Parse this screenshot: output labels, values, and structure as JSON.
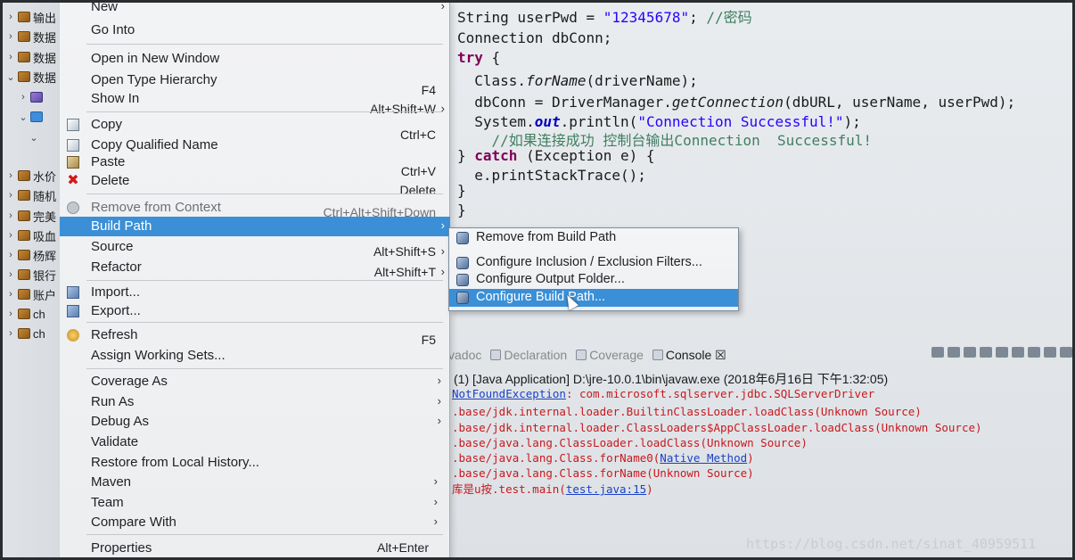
{
  "explorer": {
    "rows": [
      {
        "label": "输出",
        "twisty": "›"
      },
      {
        "label": "数据",
        "twisty": "›"
      },
      {
        "label": "数据",
        "twisty": "›"
      },
      {
        "label": "数据",
        "twisty": "⌄"
      },
      {
        "label": "",
        "twisty": "›"
      },
      {
        "label": "",
        "twisty": "⌄"
      },
      {
        "label": "",
        "twisty": "⌄"
      },
      {
        "label": "水价",
        "twisty": "›"
      },
      {
        "label": "随机",
        "twisty": "›"
      },
      {
        "label": "完美",
        "twisty": "›"
      },
      {
        "label": "吸血",
        "twisty": "›"
      },
      {
        "label": "杨辉",
        "twisty": "›"
      },
      {
        "label": "银行",
        "twisty": "›"
      },
      {
        "label": "账户",
        "twisty": "›"
      },
      {
        "label": "ch",
        "twisty": "›"
      },
      {
        "label": "ch",
        "twisty": "›"
      }
    ]
  },
  "editor": {
    "lines": [
      {
        "plain": "String userPwd = ",
        "str": "\"12345678\"",
        "rest": "; ",
        "comment": "//密码"
      },
      {
        "plain": "Connection dbConn;"
      },
      {
        "kw": "try",
        "rest": " {"
      },
      {
        "indent": "  ",
        "plain": "Class.",
        "it": "forName",
        "rest": "(driverName);"
      },
      {
        "indent": "  ",
        "plain": "dbConn = DriverManager.",
        "it": "getConnection",
        "rest": "(dbURL, userName, userPwd);"
      },
      {
        "indent": "  ",
        "plain": "System.",
        "fld": "out",
        "rest": ".println(",
        "str": "\"Connection Successful!\"",
        "end": ");"
      },
      {
        "indent": "    ",
        "comment": "//如果连接成功 控制台输出Connection  Successful!"
      },
      {
        "rest": "} ",
        "kw": "catch",
        "plain": " (Exception e) {"
      },
      {
        "indent": "  ",
        "plain": "e.printStackTrace();"
      },
      {
        "plain": "}"
      },
      {
        "plain": "}"
      }
    ]
  },
  "context_menu": {
    "items": [
      {
        "label": "New",
        "shortcut": "",
        "arrow": "›"
      },
      {
        "label": "Go Into",
        "shortcut": "",
        "arrow": ""
      },
      {
        "label": "Open in New Window",
        "shortcut": "",
        "arrow": ""
      },
      {
        "label": "Open Type Hierarchy",
        "shortcut": "F4",
        "arrow": ""
      },
      {
        "label": "Show In",
        "shortcut": "Alt+Shift+W",
        "arrow": "›"
      },
      {
        "label": "Copy",
        "shortcut": "Ctrl+C",
        "arrow": ""
      },
      {
        "label": "Copy Qualified Name",
        "shortcut": "",
        "arrow": ""
      },
      {
        "label": "Paste",
        "shortcut": "Ctrl+V",
        "arrow": ""
      },
      {
        "label": "Delete",
        "shortcut": "Delete",
        "arrow": ""
      },
      {
        "label": "Remove from Context",
        "shortcut": "Ctrl+Alt+Shift+Down",
        "arrow": ""
      },
      {
        "label": "Build Path",
        "shortcut": "",
        "arrow": "›"
      },
      {
        "label": "Source",
        "shortcut": "Alt+Shift+S",
        "arrow": "›"
      },
      {
        "label": "Refactor",
        "shortcut": "Alt+Shift+T",
        "arrow": "›"
      },
      {
        "label": "Import...",
        "shortcut": "",
        "arrow": ""
      },
      {
        "label": "Export...",
        "shortcut": "",
        "arrow": ""
      },
      {
        "label": "Refresh",
        "shortcut": "F5",
        "arrow": ""
      },
      {
        "label": "Assign Working Sets...",
        "shortcut": "",
        "arrow": ""
      },
      {
        "label": "Coverage As",
        "shortcut": "",
        "arrow": "›"
      },
      {
        "label": "Run As",
        "shortcut": "",
        "arrow": "›"
      },
      {
        "label": "Debug As",
        "shortcut": "",
        "arrow": "›"
      },
      {
        "label": "Validate",
        "shortcut": "",
        "arrow": ""
      },
      {
        "label": "Restore from Local History...",
        "shortcut": "",
        "arrow": ""
      },
      {
        "label": "Maven",
        "shortcut": "",
        "arrow": "›"
      },
      {
        "label": "Team",
        "shortcut": "",
        "arrow": "›"
      },
      {
        "label": "Compare With",
        "shortcut": "",
        "arrow": "›"
      },
      {
        "label": "Properties",
        "shortcut": "Alt+Enter",
        "arrow": ""
      }
    ]
  },
  "build_path_submenu": {
    "items": [
      {
        "label": "Remove from Build Path"
      },
      {
        "label": "Configure Inclusion / Exclusion Filters..."
      },
      {
        "label": "Configure Output Folder..."
      },
      {
        "label": "Configure Build Path..."
      }
    ],
    "highlighted": "Configure Build Path..."
  },
  "console": {
    "tabs": [
      {
        "label": "vadoc",
        "active": false
      },
      {
        "label": "Declaration",
        "active": false
      },
      {
        "label": "Coverage",
        "active": false
      },
      {
        "label": "Console ☒",
        "active": true
      }
    ],
    "header": "(1) [Java Application] D:\\jre-10.0.1\\bin\\javaw.exe (2018年6月16日 下午1:32:05)",
    "lines": [
      {
        "pre": "",
        "link": "NotFoundException",
        "post": ": com.microsoft.sqlserver.jdbc.SQLServerDriver"
      },
      {
        "pre": ".base/jdk.internal.loader.BuiltinClassLoader.loadClass(Unknown Source)",
        "link": "",
        "post": ""
      },
      {
        "pre": ".base/jdk.internal.loader.ClassLoaders$AppClassLoader.loadClass(Unknown Source)",
        "link": "",
        "post": ""
      },
      {
        "pre": ".base/java.lang.ClassLoader.loadClass(Unknown Source)",
        "link": "",
        "post": ""
      },
      {
        "pre": ".base/java.lang.Class.forName0(",
        "link": "Native Method",
        "post": ")"
      },
      {
        "pre": ".base/java.lang.Class.forName(Unknown Source)",
        "link": "",
        "post": ""
      },
      {
        "pre": "库是u按.test.main(",
        "link": "test.java:15",
        "post": ")"
      }
    ]
  },
  "watermark": "https://blog.csdn.net/sinat_40959511",
  "colors": {
    "menu_highlight": "#3b8fd6",
    "console_error": "#c8181d",
    "keyword": "#7f0055",
    "string": "#2a00ff",
    "comment": "#3f7f5f"
  }
}
